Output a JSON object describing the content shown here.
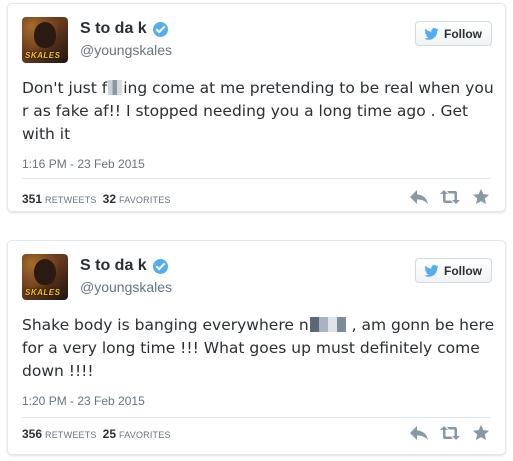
{
  "tweets": [
    {
      "display_name": "S to da k",
      "handle": "@youngskales",
      "avatar_brand": "SKALES",
      "follow_label": "Follow",
      "text_parts": [
        "Don't just f",
        "ing come at me pretending to be real when you r as fake af!!  I stopped needing you a long time ago . Get with it"
      ],
      "timestamp": "1:16 PM - 23 Feb 2015",
      "retweets": "351",
      "retweets_label": "RETWEETS",
      "favorites": "32",
      "favorites_label": "FAVORITES"
    },
    {
      "display_name": "S to da k",
      "handle": "@youngskales",
      "avatar_brand": "SKALES",
      "follow_label": "Follow",
      "text_parts": [
        "Shake body is banging everywhere n",
        " , am gonn be here for a very long time !!! What goes up must definitely come down !!!!"
      ],
      "timestamp": "1:20 PM - 23 Feb 2015",
      "retweets": "356",
      "retweets_label": "RETWEETS",
      "favorites": "25",
      "favorites_label": "FAVORITES"
    }
  ],
  "icons": {
    "verified": "verified-badge-icon",
    "follow_bird": "twitter-bird-icon",
    "reply": "reply-icon",
    "retweet": "retweet-icon",
    "favorite": "star-icon"
  },
  "colors": {
    "verified_blue": "#55acee",
    "text": "#292f33",
    "muted": "#66757f",
    "action_gray": "#8899a6"
  }
}
